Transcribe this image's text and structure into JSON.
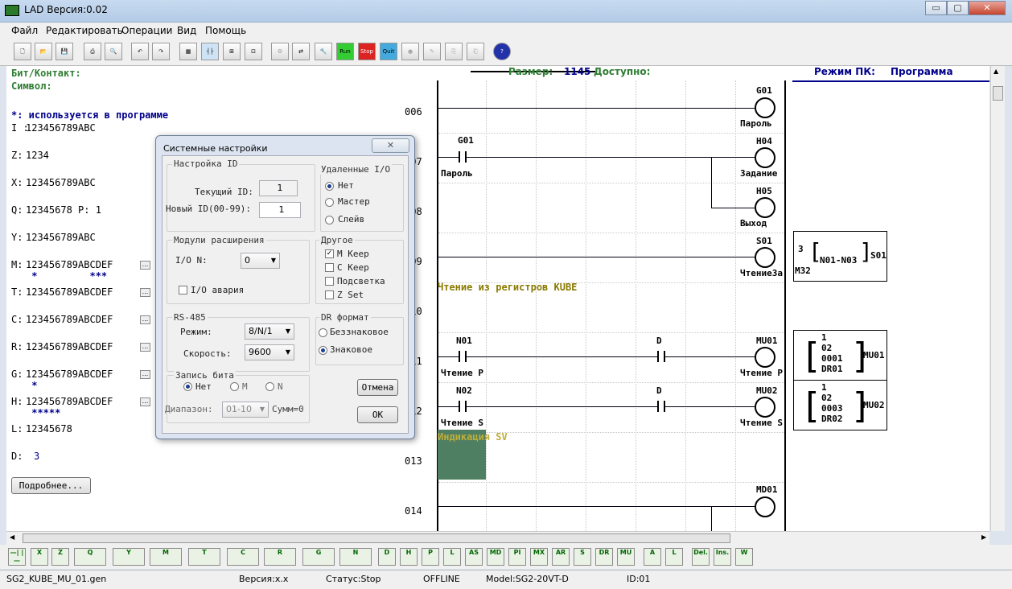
{
  "window": {
    "title": "LAD Версия:0.02",
    "min": "▭",
    "max": "▢",
    "close": "✕"
  },
  "menu": [
    "Файл",
    "Редактировать",
    "Операции",
    "Вид",
    "Помощь"
  ],
  "toolbar": {
    "run": "Run",
    "stop": "Stop",
    "quit": "Quit"
  },
  "info": {
    "size_label": "Размер:",
    "size_value": "1145",
    "avail_label": "Доступно:",
    "mode_label": "Режим ПК:",
    "mode_value": "Программа"
  },
  "left": {
    "bit_contact": "Бит/Контакт:",
    "symbol": "Символ:",
    "used": "*: используется в программе",
    "rows": [
      {
        "label": "I :",
        "value": "123456789ABC"
      },
      {
        "label": "Z:",
        "value": "1234"
      },
      {
        "label": "X:",
        "value": "123456789ABC"
      },
      {
        "label": "Q:",
        "value": "12345678  P: 1"
      },
      {
        "label": "Y:",
        "value": "123456789ABC"
      },
      {
        "label": "M:",
        "value": "123456789ABCDEF",
        "marks": " *         ***"
      },
      {
        "label": "T:",
        "value": "123456789ABCDEF"
      },
      {
        "label": "C:",
        "value": "123456789ABCDEF"
      },
      {
        "label": "R:",
        "value": "123456789ABCDEF"
      },
      {
        "label": "G:",
        "value": "123456789ABCDEF",
        "marks": " *"
      },
      {
        "label": "H:",
        "value": "123456789ABCDEF",
        "marks": " *****"
      },
      {
        "label": "L:",
        "value": "12345678"
      },
      {
        "label": "D:",
        "value": "3"
      }
    ],
    "more_button": "Подробнее..."
  },
  "ladder": {
    "rows": [
      "006",
      "007",
      "008",
      "009",
      "010",
      "011",
      "012",
      "013",
      "014"
    ],
    "comment1": "Чтение из регистров KUBE",
    "comment2": "Индикация SV",
    "elements": {
      "g01_coil": "G01",
      "g01_coil_desc": "Пароль",
      "g01_contact": "G01",
      "g01_contact_desc": "Пароль",
      "h04": "H04",
      "h04_desc": "Задание",
      "h05": "H05",
      "h05_desc": "Выход",
      "s01": "S01",
      "s01_desc": "Чтение3а",
      "n01": "N01",
      "n01_desc": "Чтение P",
      "d1": "D",
      "mu01": "MU01",
      "mu01_desc": "Чтение P",
      "n02": "N02",
      "n02_desc": "Чтение S",
      "d2": "D",
      "mu02": "MU02",
      "mu02_desc": "Чтение S",
      "md01": "MD01"
    },
    "box_s01": {
      "l1": "3",
      "l2": "N01-N03",
      "l3": "M32",
      "side": "S01"
    },
    "box_mu01": {
      "l1": "1",
      "l2": "02",
      "l3": "0001",
      "l4": "DR01",
      "side": "MU01"
    },
    "box_mu02": {
      "l1": "1",
      "l2": "02",
      "l3": "0003",
      "l4": "DR02",
      "side": "MU02"
    }
  },
  "dialog": {
    "title": "Системные настройки",
    "close": "✕",
    "id_group": "Настройка ID",
    "current_id_label": "Текущий ID:",
    "current_id": "1",
    "new_id_label": "Новый ID(00-99):",
    "new_id": "1",
    "remote_group": "Удаленные I/O",
    "remote_options": [
      "Нет",
      "Мастер",
      "Слейв"
    ],
    "ext_group": "Модули расширения",
    "io_n_label": "I/O N:",
    "io_n_value": "0",
    "io_alarm": "I/O авария",
    "other_group": "Другое",
    "other_options": [
      "M Keep",
      "C Keep",
      "Подсветка",
      "Z Set"
    ],
    "rs_group": "RS-485",
    "mode_label": "Режим:",
    "mode_value": "8/N/1",
    "speed_label": "Скорость:",
    "speed_value": "9600",
    "dr_group": "DR формат",
    "dr_options": [
      "Беззнаковое",
      "Знаковое"
    ],
    "write_group": "Запись бита",
    "write_options": [
      "Нет",
      "M",
      "N"
    ],
    "range_label": "Диапазон:",
    "range_value": "01-10",
    "sum_label": "Сумм=0",
    "cancel": "Отмена",
    "ok": "OK"
  },
  "bottom_tools": [
    "—|  |—",
    "X",
    "Z",
    "Q",
    "Y",
    "M",
    "T",
    "C",
    "R",
    "G",
    "N",
    "D",
    "H",
    "P",
    "L",
    "AS",
    "MD",
    "PI",
    "MX",
    "AR",
    "S",
    "DR",
    "MU",
    "A",
    "L",
    "Del.",
    "Ins.",
    "W"
  ],
  "status": {
    "file": "SG2_KUBE_MU_01.gen",
    "version": "Версия:x.x",
    "state": "Статус:Stop",
    "online": "OFFLINE",
    "model": "Model:SG2-20VT-D",
    "id": "ID:01"
  },
  "colors": {
    "green": "#2e7d32",
    "navy": "#00008b",
    "olive": "#8a7a00",
    "highlight": "#4f7f62"
  }
}
